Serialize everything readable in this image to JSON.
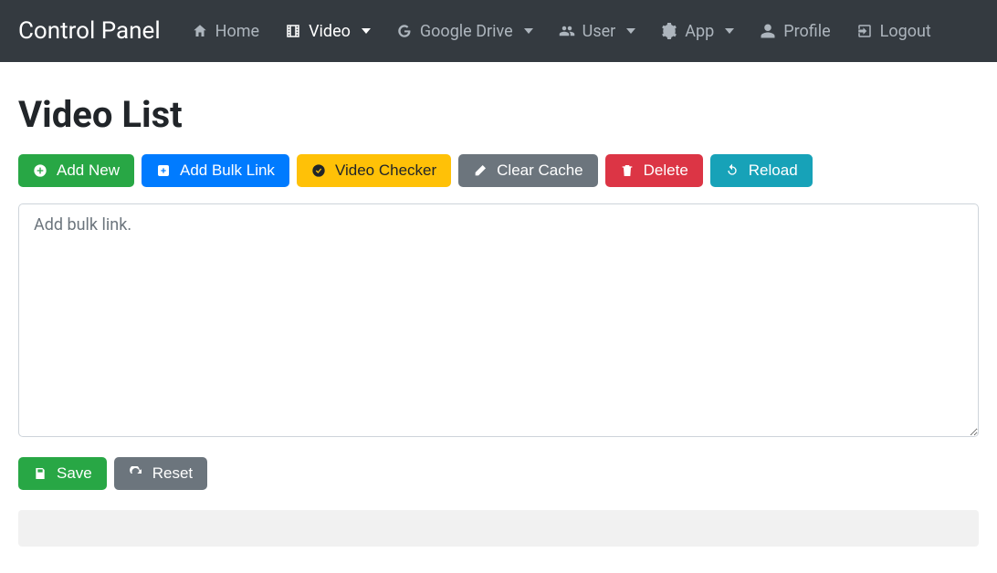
{
  "brand": "Control Panel",
  "nav": {
    "home": {
      "label": "Home"
    },
    "video": {
      "label": "Video",
      "active": true
    },
    "gdrive": {
      "label": "Google Drive"
    },
    "user": {
      "label": "User"
    },
    "app": {
      "label": "App"
    },
    "profile": {
      "label": "Profile"
    },
    "logout": {
      "label": "Logout"
    }
  },
  "page": {
    "title": "Video List"
  },
  "toolbar": {
    "add_new": "Add New",
    "add_bulk": "Add Bulk Link",
    "video_checker": "Video Checker",
    "clear_cache": "Clear Cache",
    "delete": "Delete",
    "reload": "Reload"
  },
  "bulk": {
    "placeholder": "Add bulk link."
  },
  "actions": {
    "save": "Save",
    "reset": "Reset"
  }
}
